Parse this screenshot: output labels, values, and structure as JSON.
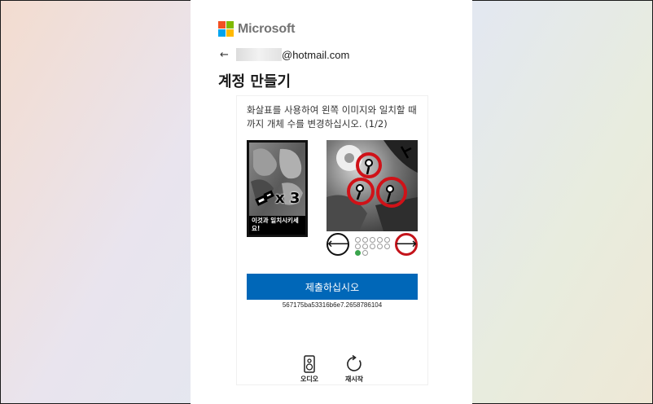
{
  "brand": {
    "name": "Microsoft",
    "colors": [
      "#f25022",
      "#7fba00",
      "#00a4ef",
      "#ffb900"
    ]
  },
  "account": {
    "back_icon": "back-arrow-icon",
    "email_suffix": "@hotmail.com"
  },
  "page": {
    "title": "계정 만들기"
  },
  "puzzle": {
    "instruction": "화살표를 사용하여 왼쪽 이미지와 일치할 때까지 개체 수를 변경하십시오. (1/2)",
    "reference_count_label": "x 3",
    "reference_caption": "이것과 일치시키세요!",
    "prev_icon": "arrow-left-icon",
    "next_icon": "arrow-right-icon",
    "total_options": 12,
    "current_option": 1,
    "submit_label": "제출하십시오",
    "session_id": "567175ba53316b6e7.2658786104"
  },
  "tools": {
    "audio_label": "오디오",
    "reload_label": "재시작"
  },
  "colors": {
    "accent": "#0067b8",
    "highlight_red": "#c4141b",
    "progress_green": "#3aa44c"
  }
}
